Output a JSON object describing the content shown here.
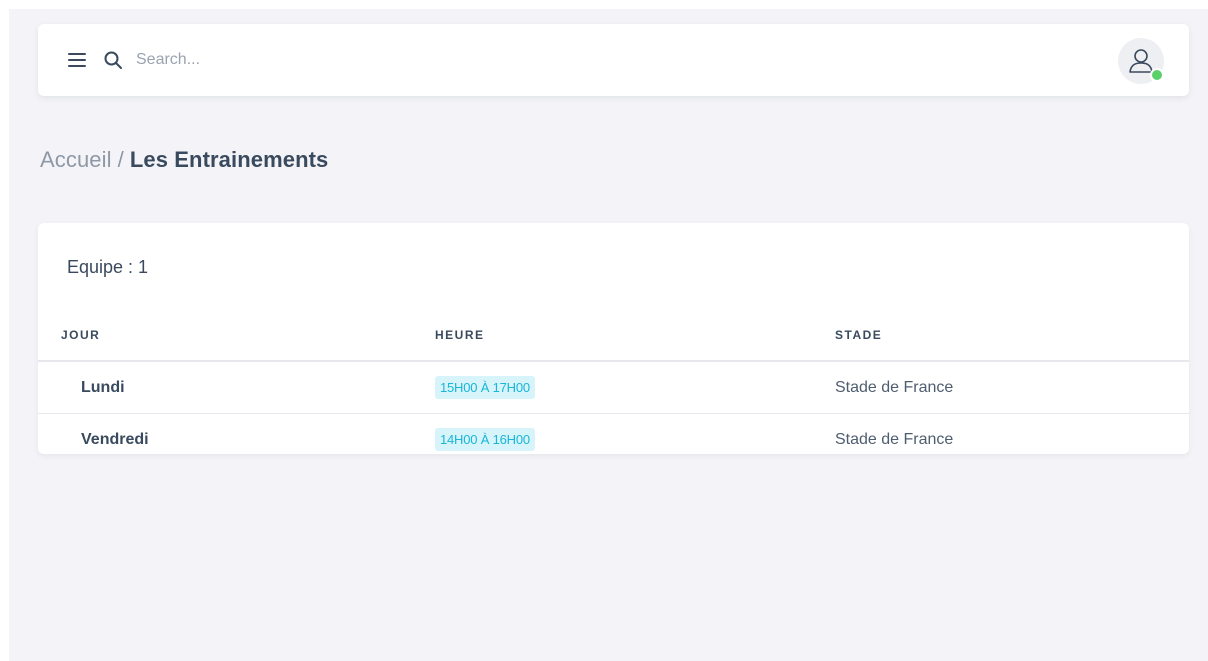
{
  "header": {
    "search_placeholder": "Search...",
    "status_color": "#5ad06a"
  },
  "breadcrumb": {
    "root": "Accueil",
    "separator": "/",
    "current": "Les Entrainements"
  },
  "card": {
    "title": "Equipe : 1",
    "columns": [
      "JOUR",
      "HEURE",
      "STADE"
    ],
    "rows": [
      {
        "jour": "Lundi",
        "heure": "15H00 À 17H00",
        "stade": "Stade de France"
      },
      {
        "jour": "Vendredi",
        "heure": "14H00 À 16H00",
        "stade": "Stade de France"
      }
    ]
  },
  "colors": {
    "background": "#f4f4f8",
    "badge_background": "#d6f4fa",
    "badge_text": "#18b6d8",
    "text_dark": "#3a4a5e",
    "text_muted": "#8e98a6"
  }
}
